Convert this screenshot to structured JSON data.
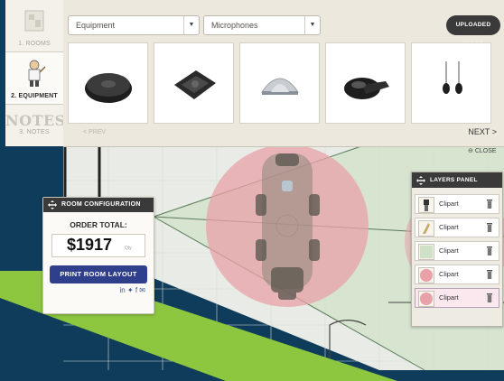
{
  "steps": [
    {
      "label": "1. ROOMS"
    },
    {
      "label": "2. EQUIPMENT"
    },
    {
      "big": "NOTES",
      "label": "3. NOTES"
    }
  ],
  "equipment_bar": {
    "category_select": "Equipment",
    "subcategory_select": "Microphones",
    "upload_button": "UPLOADED IMAGE",
    "prev": "< PREV",
    "next": "NEXT >",
    "close": "CLOSE"
  },
  "room_config": {
    "title": "ROOM CONFIGURATION",
    "order_label": "ORDER TOTAL:",
    "total": "$1917",
    "total_suffix": "Qty",
    "print_button": "PRINT ROOM LAYOUT",
    "share": "in  ✦  f  ✉"
  },
  "layers_panel": {
    "title": "LAYERS PANEL",
    "items": [
      {
        "label": "Clipart"
      },
      {
        "label": "Clipart"
      },
      {
        "label": "Clipart"
      },
      {
        "label": "Clipart"
      },
      {
        "label": "Clipart"
      }
    ]
  },
  "colors": {
    "background": "#0e3c5a",
    "green_stripe": "#8dc63f",
    "mic_zone": "#e8a1a8",
    "panel_header": "#3a3a3a",
    "print_button": "#2f3f8c"
  }
}
